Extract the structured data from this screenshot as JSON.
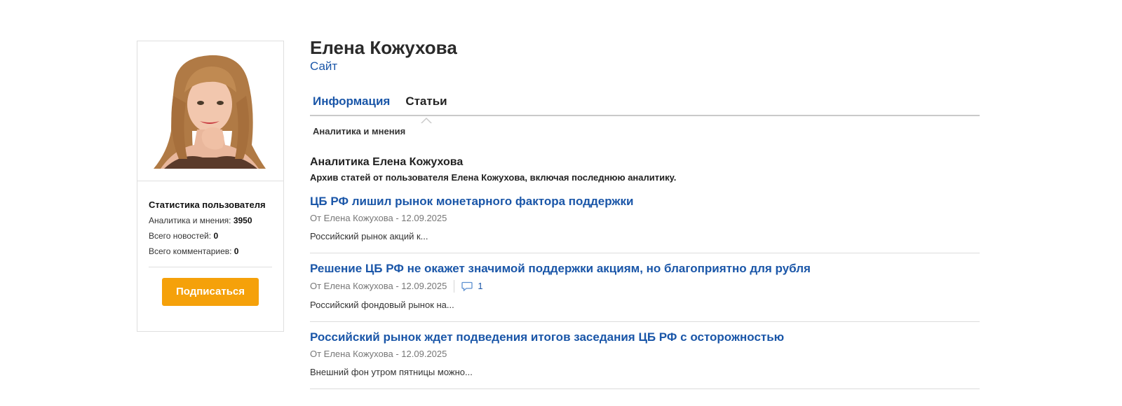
{
  "profile": {
    "name": "Елена Кожухова",
    "site_link": "Сайт",
    "stats_title": "Статистика пользователя",
    "stats": [
      {
        "label": "Аналитика и мнения:",
        "value": "3950"
      },
      {
        "label": "Всего новостей:",
        "value": "0"
      },
      {
        "label": "Всего комментариев:",
        "value": "0"
      }
    ],
    "subscribe_label": "Подписаться"
  },
  "tabs": [
    {
      "label": "Информация",
      "active": false
    },
    {
      "label": "Статьи",
      "active": true
    }
  ],
  "subtab": "Аналитика и мнения",
  "section": {
    "heading": "Аналитика Елена Кожухова",
    "description": "Архив статей от пользователя Елена Кожухова, включая последнюю аналитику."
  },
  "articles": [
    {
      "title": "ЦБ РФ лишил рынок монетарного фактора поддержки",
      "meta": "От Елена Кожухова - 12.09.2025",
      "comments": null,
      "snippet": "Российский рынок акций к..."
    },
    {
      "title": "Решение ЦБ РФ не окажет значимой поддержки акциям, но благоприятно для рубля",
      "meta": "От Елена Кожухова - 12.09.2025",
      "comments": "1",
      "snippet": "Российский фондовый рынок на..."
    },
    {
      "title": "Российский рынок ждет подведения итогов заседания ЦБ РФ с осторожностью",
      "meta": "От Елена Кожухова - 12.09.2025",
      "comments": null,
      "snippet": "Внешний фон утром пятницы можно..."
    }
  ],
  "colors": {
    "link": "#1a56a8",
    "subscribe_button": "#f5a10a",
    "border": "#dfdfdf"
  },
  "icons": {
    "comment": "comment-icon"
  }
}
